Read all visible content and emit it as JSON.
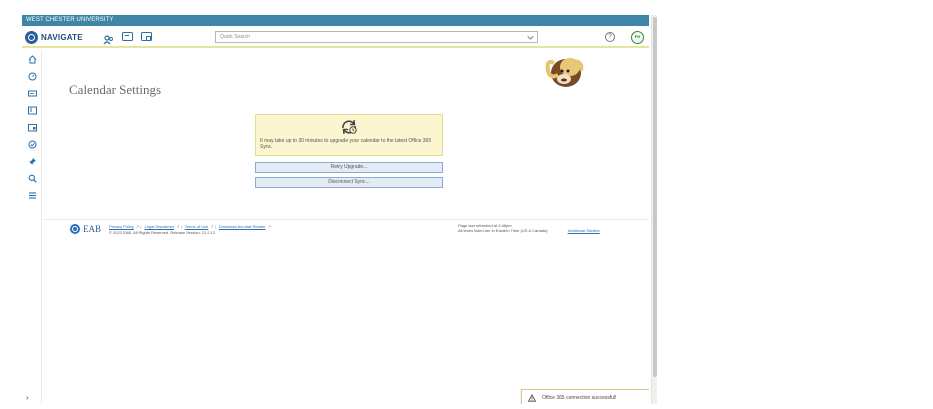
{
  "topbar": {
    "org_name": "WEST CHESTER UNIVERSITY"
  },
  "navbar": {
    "brand": "NAVIGATE",
    "search_placeholder": "Quick Search",
    "help_label": "?",
    "avatar_initials": "PH"
  },
  "sidebar": {
    "items": [
      {
        "icon": "home-icon"
      },
      {
        "icon": "dashboard-icon"
      },
      {
        "icon": "card-icon"
      },
      {
        "icon": "list-card-icon"
      },
      {
        "icon": "calendar-icon"
      },
      {
        "icon": "check-circle-icon"
      },
      {
        "icon": "pin-icon"
      },
      {
        "icon": "search-icon"
      },
      {
        "icon": "list-icon"
      }
    ],
    "expand_label": "›"
  },
  "page": {
    "title": "Calendar Settings",
    "notice_text": "It may take up to 30 minutes to upgrade your calendar to the latest Office 365 Sync.",
    "retry_button": "Retry Upgrade...",
    "disconnect_button": "Disconnect Sync..."
  },
  "footer": {
    "logo_text": "EAB",
    "links": [
      "Privacy Policy",
      "Legal Disclaimer",
      "Terms of Use",
      "Download Acrobat Reader"
    ],
    "copyright": "© 2022 EAB. All Rights Reserved. Release Version: 21.2.12",
    "refresh_text": "Page last refreshed at 2:46pm",
    "timezone_text": "All times listed are in Eastern Time (US & Canada)",
    "studies_link": "Additional Studies"
  },
  "toast": {
    "message": "Office 365 connection successful!",
    "close_label": "×"
  },
  "colors": {
    "topbar": "#3f86a6",
    "accent_yellow": "#e6e59c",
    "brand_blue": "#234a7c",
    "link_blue": "#2f6fb6",
    "notice_bg": "#fbf6cf",
    "toast_border": "#e4c48d"
  }
}
